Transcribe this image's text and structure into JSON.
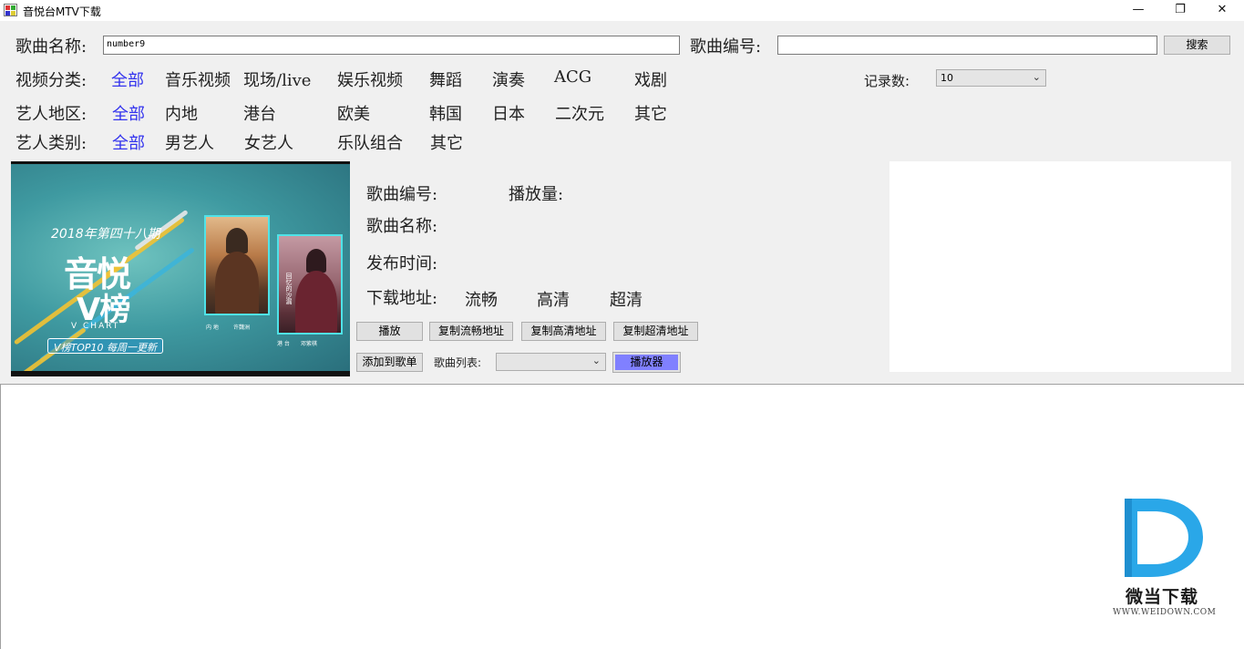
{
  "window": {
    "title": "音悦台MTV下载",
    "minimize_glyph": "—",
    "maximize_glyph": "❐",
    "close_glyph": "✕"
  },
  "search": {
    "song_name_label": "歌曲名称:",
    "song_name_value": "number9",
    "song_id_label": "歌曲编号:",
    "song_id_value": "",
    "search_button": "搜索"
  },
  "filters": {
    "video_category": {
      "label": "视频分类:",
      "options": [
        "全部",
        "音乐视频",
        "现场/live",
        "娱乐视频",
        "舞蹈",
        "演奏",
        "ACG",
        "戏剧"
      ]
    },
    "artist_region": {
      "label": "艺人地区:",
      "options": [
        "全部",
        "内地",
        "港台",
        "欧美",
        "韩国",
        "日本",
        "二次元",
        "其它"
      ]
    },
    "artist_type": {
      "label": "艺人类别:",
      "options": [
        "全部",
        "男艺人",
        "女艺人",
        "乐队组合",
        "其它"
      ]
    },
    "selected_color": "#3333ee",
    "record_count_label": "记录数:",
    "record_count_value": "10"
  },
  "cover": {
    "issue": "2018年第四十八期",
    "logo_line1": "音悦",
    "logo_line2": "V榜",
    "vchart": "V CHART",
    "tagline": "V榜TOP10  每周一更新",
    "caption1_region": "内 地",
    "caption1_name": "许魏洲",
    "caption2_region": "港 台",
    "caption2_name": "邓紫棋",
    "caption2_vertical": "回忆的沙漏"
  },
  "details": {
    "song_id_label": "歌曲编号:",
    "play_count_label": "播放量:",
    "song_name_label": "歌曲名称:",
    "release_time_label": "发布时间:",
    "download_label": "下载地址:",
    "quality_smooth": "流畅",
    "quality_hd": "高清",
    "quality_super": "超清"
  },
  "actions": {
    "play": "播放",
    "copy_smooth": "复制流畅地址",
    "copy_hd": "复制高清地址",
    "copy_super": "复制超清地址",
    "add_to_playlist": "添加到歌单",
    "playlist_label": "歌曲列表:",
    "playlist_value": "",
    "player": "播放器",
    "player_color": "#8080ff"
  },
  "watermark": {
    "name": "微当下载",
    "url": "WWW.WEIDOWN.COM",
    "color": "#2aa7e8"
  }
}
